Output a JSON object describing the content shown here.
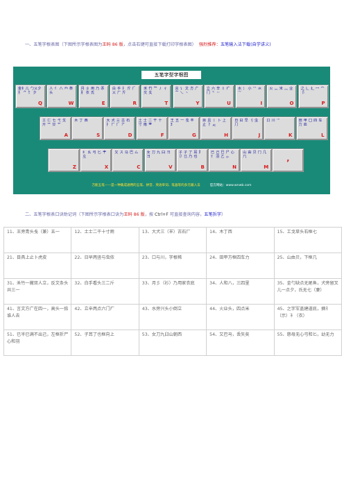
{
  "heading1": {
    "prefix": "一、五笔字根表",
    "text1": "图（下图所示字根表图为",
    "version": "王码 86 版",
    "text2": "，点击右键可直接下载打印字根表图）",
    "recommend": "强烈推荐：",
    "link": "五笔输入法下载(自学讲义)"
  },
  "keyboard": {
    "title": "五笔字型字根图",
    "keys": [
      {
        "letter": "Q",
        "roots": "金钅儿 勹乂夕 犭 ⺈ 饣 夕"
      },
      {
        "letter": "W",
        "roots": "人 亻 八 癶 祭头"
      },
      {
        "letter": "E",
        "roots": "月 彡 用 乃 豕 ⺼ 衣 氏"
      },
      {
        "letter": "R",
        "roots": "白 手 扌 斤 ⺁ 乂 厂 斤"
      },
      {
        "letter": "T",
        "roots": "禾 竹 ⺮ 丿 彳 攵 夂"
      },
      {
        "letter": "Y",
        "roots": "言 讠 文 方 广 亠 乀 丶"
      },
      {
        "letter": "U",
        "roots": "立 六 辛 丬 疒 门 ⺀ 丷"
      },
      {
        "letter": "I",
        "roots": "水 氵 小 ⺌ 氺 ⺍"
      },
      {
        "letter": "O",
        "roots": "火 灬 米 ⺣ 业"
      },
      {
        "letter": "P",
        "roots": "之 辶 廴 冖 宀 ⻏"
      },
      {
        "letter": "A",
        "roots": "工 匚 七 弋 戈 廾 艹 廿 ⺾"
      },
      {
        "letter": "S",
        "roots": "木 丁 西"
      },
      {
        "letter": "D",
        "roots": "大 犬 三 古 石 ⺘ 厂 ⺁ 丆"
      },
      {
        "letter": "F",
        "roots": "土 士 二 干 十 寸 雨 ⺻"
      },
      {
        "letter": "G",
        "roots": "王 五 一 戋 丰 ⺩"
      },
      {
        "letter": "H",
        "roots": "目 且 丨 卜 上 止 ⺊ 龰"
      },
      {
        "letter": "J",
        "roots": "日 曰 早 刂 虫 ⺆"
      },
      {
        "letter": "K",
        "roots": "口 川 ⺌"
      },
      {
        "letter": "L",
        "roots": "田 甲 囗 四 车 力 皿"
      },
      {
        "letter": "Z",
        "roots": ""
      },
      {
        "letter": "X",
        "roots": "纟 幺 弓 匕 ⺺ 彑"
      },
      {
        "letter": "C",
        "roots": "又 ス 马 巴 厶"
      },
      {
        "letter": "V",
        "roots": "女 刀 九 臼 彐 ⺕"
      },
      {
        "letter": "B",
        "roots": "子 孑 了 耳 阝 卩 ⺋ 乃 也"
      },
      {
        "letter": "N",
        "roots": "已 己 巳 尸 心 忄 羽 乙 ⺗"
      },
      {
        "letter": "M",
        "roots": "山 由 贝 冂 几 ⺇"
      },
      {
        "letter": ",",
        "roots": ""
      }
    ],
    "footer": "万能五笔——是一种集成通用的五笔、拼音、英语单词、笔画等的多元输入法",
    "site": "官方网站：www.wnwb.com"
  },
  "heading2": {
    "prefix": "二、五笔字根表",
    "text1": "口诀助记词（下图所示字根表口诀为",
    "version": "王码 86 版",
    "text2": "，按 ",
    "shortcut": "Ctrl+F",
    "text3": " 可直接查询内容，",
    "link": "五笔拆字",
    "text4": "）"
  },
  "mnemonics": [
    [
      "11、王旁青头戋（兼）五一",
      "12、土士二干十寸雨",
      "13、大犬三（羊）古石厂",
      "14、木丁西",
      "15、工戈草头右框七"
    ],
    [
      "21、目具上止卜虎皮",
      "22、日早两竖与虫依",
      "23、口与川，字根稀",
      "24、田甲方框四车力",
      "25、山由贝，下框几"
    ],
    [
      "31、禾竹一撇双人立，反文条头共三一",
      "32、白手看头三二斤",
      "33、月彡（衫）乃用家衣底",
      "34、人和八，三四里",
      "35、金勺缺点无尾鱼，犬旁留叉儿一点夕，氏无七（妻）"
    ],
    [
      "41、言文方广在四一，高头一捺谁人去",
      "42、立辛两点六门疒",
      "43、水旁兴头小倒立",
      "44、火业头，四点米",
      "45、之字军盖建道底，摘礻（示）衤（衣）"
    ],
    [
      "51、已半已满不出己，左框折尸心和羽",
      "52、子耳了也框向上",
      "53、女刀九臼山朝西",
      "54、又巴马，丢矢矣",
      "55、慈母无心弓和匕，幼无力"
    ]
  ]
}
